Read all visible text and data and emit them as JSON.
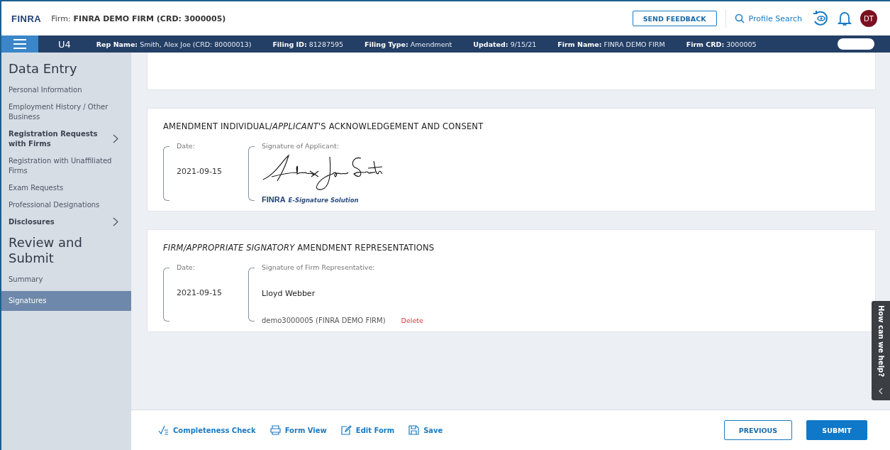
{
  "header": {
    "logo": "FINRA",
    "firm_label": "Firm:",
    "firm_value": "FINRA DEMO FIRM (CRD: 3000005)",
    "feedback_button": "SEND FEEDBACK",
    "profile_search": "Profile Search",
    "avatar": "DT"
  },
  "nav": {
    "form": "U4",
    "fields": [
      {
        "label": "Rep Name:",
        "value": "Smith, Alex Joe (CRD: 80000013)"
      },
      {
        "label": "Filing ID:",
        "value": "81287595"
      },
      {
        "label": "Filing Type:",
        "value": "Amendment"
      },
      {
        "label": "Updated:",
        "value": "9/15/21"
      },
      {
        "label": "Firm Name:",
        "value": "FINRA DEMO FIRM"
      },
      {
        "label": "Firm CRD:",
        "value": "3000005"
      }
    ]
  },
  "sidebar": {
    "groups": [
      {
        "title": "Data Entry",
        "items": [
          {
            "label": "Personal Information",
            "bold": false,
            "expandable": false,
            "selected": false
          },
          {
            "label": "Employment History / Other Business",
            "bold": false,
            "expandable": false,
            "selected": false
          },
          {
            "label": "Registration Requests with Firms",
            "bold": true,
            "expandable": true,
            "selected": false
          },
          {
            "label": "Registration with Unaffiliated Firms",
            "bold": false,
            "expandable": false,
            "selected": false
          },
          {
            "label": "Exam Requests",
            "bold": false,
            "expandable": false,
            "selected": false
          },
          {
            "label": "Professional Designations",
            "bold": false,
            "expandable": false,
            "selected": false
          },
          {
            "label": "Disclosures",
            "bold": true,
            "expandable": true,
            "selected": false
          }
        ]
      },
      {
        "title": "Review and Submit",
        "items": [
          {
            "label": "Summary",
            "bold": false,
            "expandable": false,
            "selected": false
          },
          {
            "label": "Signatures",
            "bold": false,
            "expandable": false,
            "selected": true
          }
        ]
      }
    ]
  },
  "sections": [
    {
      "kind": "signature",
      "title": "AMENDMENT INDIVIDUAL/*APPLICANT*'S ACKNOWLEDGEMENT AND CONSENT",
      "date_label": "Date:",
      "date": "2021-09-15",
      "signature_label": "Signature of Applicant:",
      "esign_logo": "FINRA",
      "esign_text": "E-Signature Solution"
    },
    {
      "kind": "typed",
      "title": "*FIRM/APPROPRIATE SIGNATORY* AMENDMENT REPRESENTATIONS",
      "date_label": "Date:",
      "date": "2021-09-15",
      "signature_label": "Signature of Firm Representative:",
      "name": "Lloyd Webber",
      "account": "demo3000005 (FINRA DEMO FIRM)",
      "delete": "Delete"
    }
  ],
  "help_tab": "How can we help?",
  "footer": {
    "actions": [
      {
        "kind": "check",
        "label": "Completeness Check"
      },
      {
        "kind": "print",
        "label": "Form View"
      },
      {
        "kind": "edit",
        "label": "Edit Form"
      },
      {
        "kind": "save",
        "label": "Save"
      }
    ],
    "previous": "PREVIOUS",
    "submit": "SUBMIT"
  }
}
